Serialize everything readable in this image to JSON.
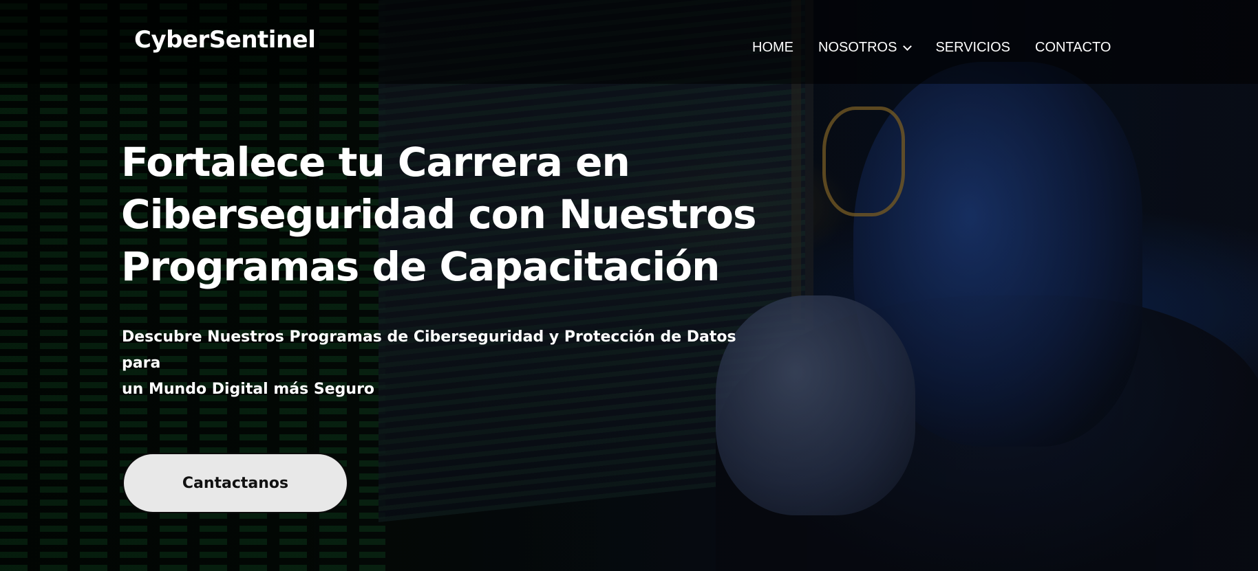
{
  "header": {
    "logo": "CyberSentinel",
    "nav": [
      {
        "label": "HOME"
      },
      {
        "label": "NOSOTROS",
        "has_dropdown": true
      },
      {
        "label": "SERVICIOS"
      },
      {
        "label": "CONTACTO"
      }
    ]
  },
  "hero": {
    "title_lines": [
      "Fortalece tu Carrera en",
      "Ciberseguridad con Nuestros",
      "Programas de Capacitación"
    ],
    "subtitle_lines": [
      "Descubre Nuestros Programas de Ciberseguridad y Protección de Datos para",
      "un Mundo Digital más Seguro"
    ],
    "cta_label": "Cantactanos",
    "background_image": "hacker-at-monitor-photo"
  },
  "colors": {
    "text": "#ffffff",
    "header_bg": "#000000",
    "cta_bg": "#e8e8e8",
    "cta_text": "#111111"
  }
}
